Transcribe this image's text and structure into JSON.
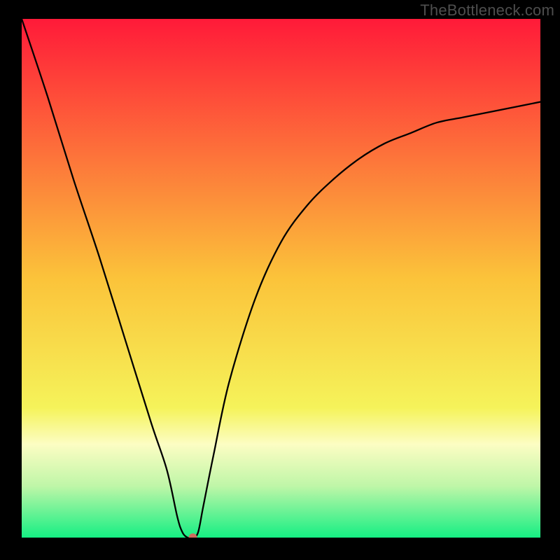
{
  "watermark": "TheBottleneck.com",
  "chart_data": {
    "type": "line",
    "title": "",
    "xlabel": "",
    "ylabel": "",
    "xlim": [
      0,
      100
    ],
    "ylim": [
      0,
      100
    ],
    "grid": false,
    "background_gradient": {
      "stops": [
        {
          "pos": 0.0,
          "color": "#ff1a39"
        },
        {
          "pos": 0.5,
          "color": "#fbc33a"
        },
        {
          "pos": 0.75,
          "color": "#f5f35a"
        },
        {
          "pos": 0.82,
          "color": "#fcfdc3"
        },
        {
          "pos": 0.9,
          "color": "#c0f6a8"
        },
        {
          "pos": 1.0,
          "color": "#15ef83"
        }
      ]
    },
    "series": [
      {
        "name": "bottleneck-curve",
        "x": [
          0,
          5,
          10,
          15,
          20,
          25,
          28,
          30,
          31,
          32,
          33,
          34,
          35,
          37,
          40,
          45,
          50,
          55,
          60,
          65,
          70,
          75,
          80,
          85,
          90,
          95,
          100
        ],
        "y": [
          100,
          85,
          69,
          54,
          38,
          22,
          13,
          4,
          1,
          0,
          0,
          1,
          6,
          16,
          30,
          46,
          57,
          64,
          69,
          73,
          76,
          78,
          80,
          81,
          82,
          83,
          84
        ]
      }
    ],
    "marker": {
      "name": "optimal-point",
      "x": 33,
      "y": 0,
      "color": "#cf6c5e",
      "radius_px": 6
    }
  }
}
